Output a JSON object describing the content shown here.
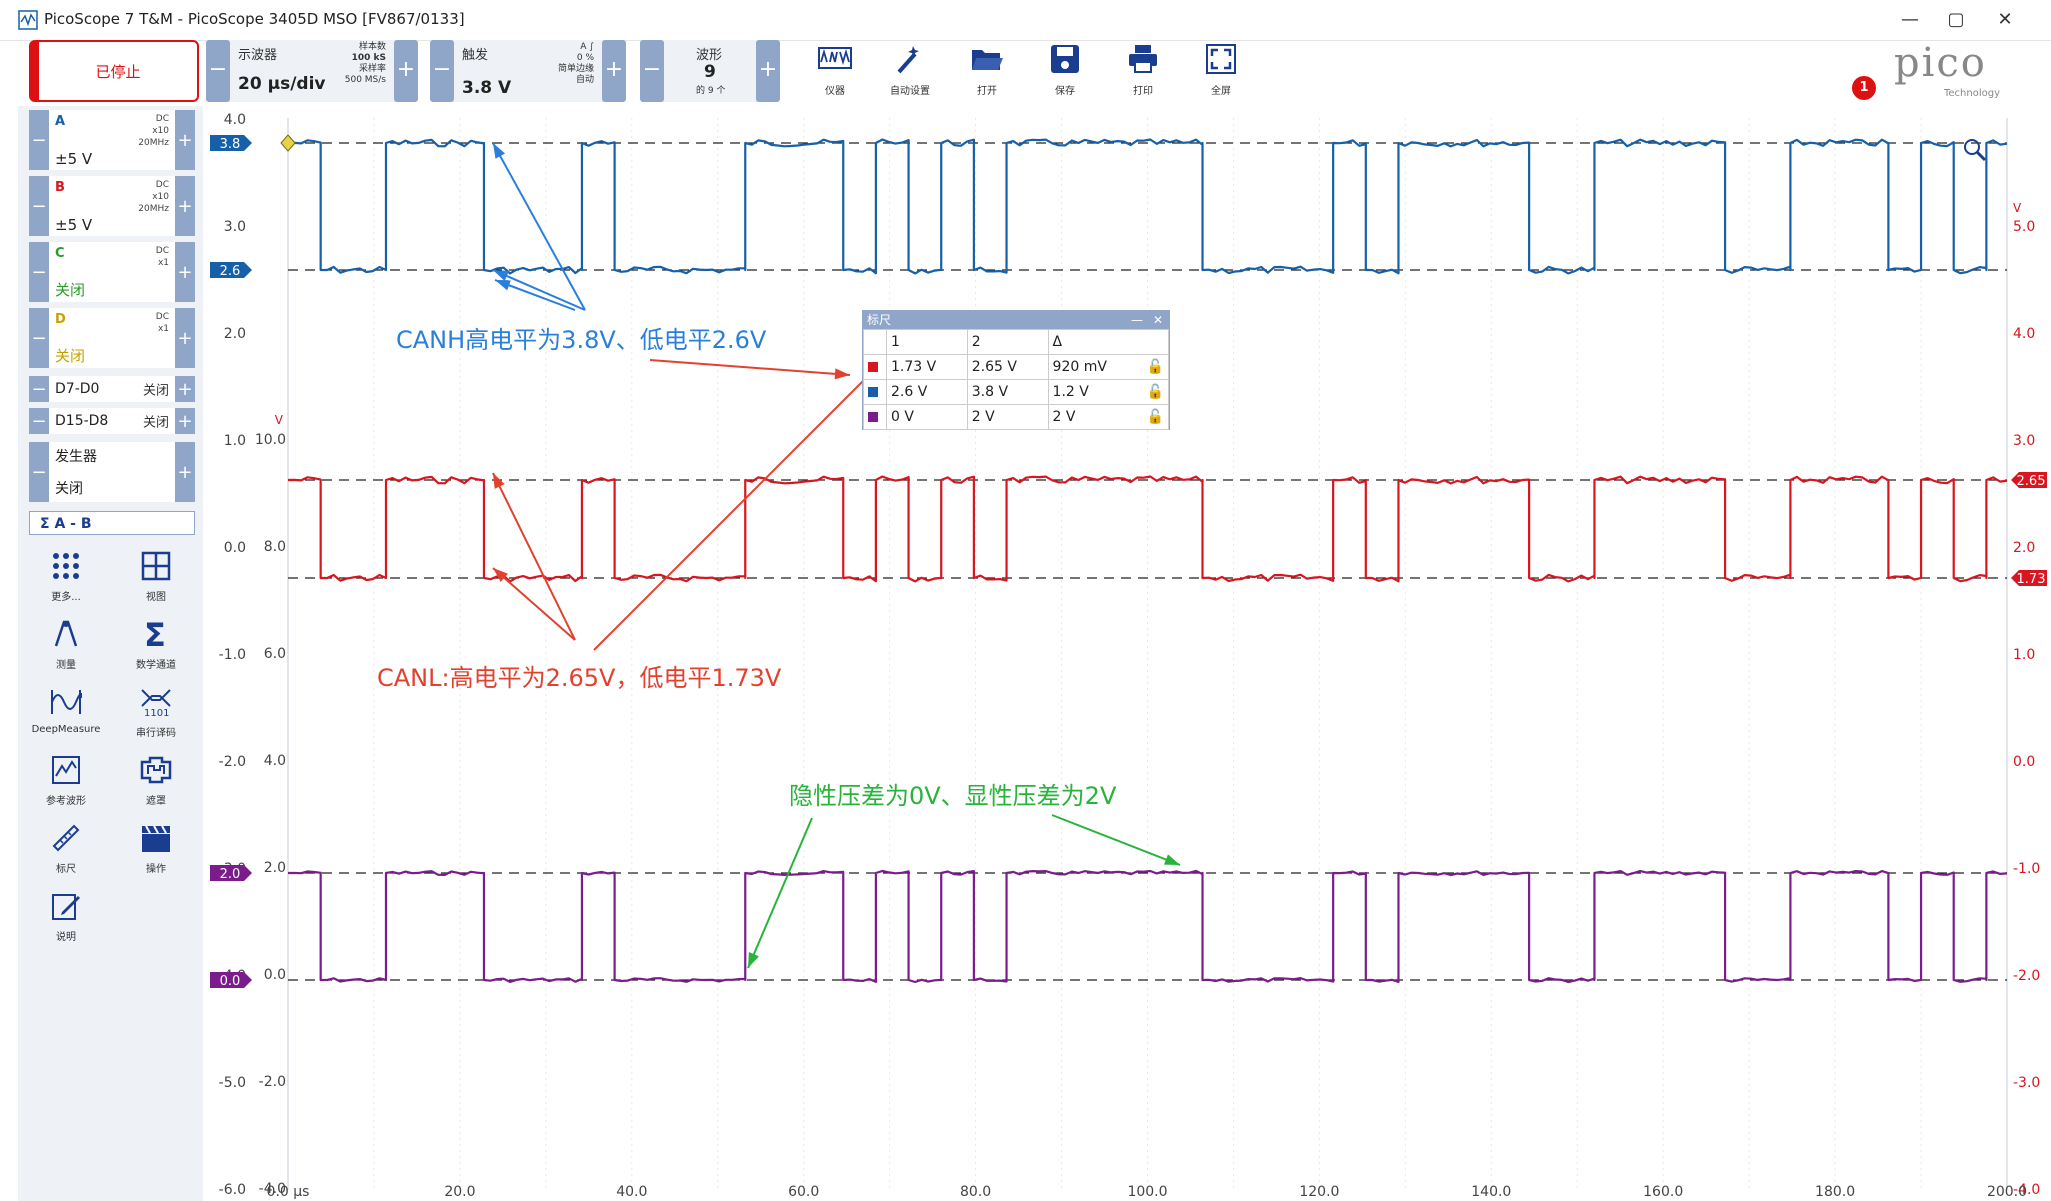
{
  "window": {
    "title": "PicoScope 7 T&M  - PicoScope 3405D MSO [FV867/0133]",
    "controls": [
      "—",
      "▢",
      "✕"
    ]
  },
  "toolbar": {
    "stop_label": "已停止",
    "scope": {
      "title": "示波器",
      "value": "20 μs/div",
      "samples_label": "样本数",
      "samples": "100 kS",
      "rate_label": "采样率",
      "rate": "500 MS/s"
    },
    "trigger": {
      "title": "触发",
      "value": "3.8 V",
      "ch": "A",
      "edge": "∫",
      "pct": "0 %",
      "mode": "简单边缘",
      "auto": "自动"
    },
    "wave": {
      "title": "波形",
      "value": "9",
      "sub": "的 9 个"
    },
    "tools": [
      {
        "label": "仪器",
        "icon": "instruments-icon"
      },
      {
        "label": "自动设置",
        "icon": "auto-setup-icon"
      },
      {
        "label": "打开",
        "icon": "open-folder-icon"
      },
      {
        "label": "保存",
        "icon": "save-icon"
      },
      {
        "label": "打印",
        "icon": "print-icon"
      },
      {
        "label": "全屏",
        "icon": "fullscreen-icon"
      }
    ],
    "notifications": "1",
    "brand": "pico",
    "brand_sub": "Technology"
  },
  "channels": [
    {
      "name": "A",
      "range": "±5 V",
      "coupling": "DC",
      "probe": "x10",
      "bw": "20MHz",
      "color": "#1560a8"
    },
    {
      "name": "B",
      "range": "±5 V",
      "coupling": "DC",
      "probe": "x10",
      "bw": "20MHz",
      "color": "#d9151f"
    },
    {
      "name": "C",
      "range": "关闭",
      "coupling": "DC",
      "probe": "x1",
      "color": "#2a9a2a"
    },
    {
      "name": "D",
      "range": "关闭",
      "coupling": "DC",
      "probe": "x1",
      "color": "#c9a100"
    }
  ],
  "digital": [
    {
      "name": "D7-D0",
      "state": "关闭"
    },
    {
      "name": "D15-D8",
      "state": "关闭"
    }
  ],
  "generator": {
    "label": "发生器",
    "state": "关闭"
  },
  "math_channel": "A - B",
  "side_tools": [
    {
      "label": "更多...",
      "icon": "more-icon"
    },
    {
      "label": "视图",
      "icon": "view-grid-icon"
    },
    {
      "label": "测量",
      "icon": "measure-icon"
    },
    {
      "label": "数学通道",
      "icon": "math-sigma-icon"
    },
    {
      "label": "DeepMeasure",
      "icon": "deepmeasure-icon"
    },
    {
      "label": "串行译码",
      "icon": "serial-decode-icon"
    },
    {
      "label": "参考波形",
      "icon": "reference-wave-icon"
    },
    {
      "label": "遮罩",
      "icon": "mask-icon"
    },
    {
      "label": "标尺",
      "icon": "ruler-icon"
    },
    {
      "label": "操作",
      "icon": "clapper-icon"
    },
    {
      "label": "说明",
      "icon": "notes-icon"
    }
  ],
  "axes": {
    "left_a": [
      "4.0",
      "3.0",
      "2.0",
      "1.0",
      "0.0",
      "-1.0",
      "-2.0",
      "-3.0",
      "-4.0",
      "-5.0",
      "-6.0"
    ],
    "left_b": [
      "10.0",
      "8.0",
      "6.0",
      "4.0",
      "2.0",
      "0.0",
      "-2.0",
      "-4.0"
    ],
    "left_b_unit": "V",
    "right": [
      "5.0",
      "4.0",
      "3.0",
      "2.0",
      "1.0",
      "0.0",
      "-1.0",
      "-2.0",
      "-3.0",
      "-4.0"
    ],
    "right_unit": "V",
    "x": [
      "0.0 μs",
      "20.0",
      "40.0",
      "60.0",
      "80.0",
      "100.0",
      "120.0",
      "140.0",
      "160.0",
      "180.0",
      "200.0"
    ]
  },
  "markers": {
    "a_hi": "3.8",
    "a_lo": "2.6",
    "b_hi": "2.65",
    "b_lo": "1.73",
    "m_hi": "2.0",
    "m_lo": "0.0"
  },
  "signal": {
    "pattern": [
      1,
      0,
      0,
      1,
      1,
      1,
      0,
      0,
      0,
      1,
      0,
      0,
      0,
      0,
      1,
      1,
      1,
      0,
      1,
      0,
      1,
      0,
      1,
      1,
      1,
      1,
      1,
      1,
      0,
      0,
      0,
      0,
      1,
      0,
      1,
      1,
      1,
      1,
      0,
      0,
      1,
      1,
      1,
      1,
      0,
      0,
      1,
      1,
      1,
      0,
      1,
      0,
      1
    ],
    "bit_us": 3.8
  },
  "ruler": {
    "title": "标尺",
    "headers": [
      "1",
      "2",
      "Δ"
    ],
    "rows": [
      {
        "color": "#d9151f",
        "v1": "1.73 V",
        "v2": "2.65 V",
        "d": "920 mV"
      },
      {
        "color": "#1560a8",
        "v1": "2.6 V",
        "v2": "3.8 V",
        "d": "1.2 V"
      },
      {
        "color": "#7a1c8c",
        "v1": "0 V",
        "v2": "2 V",
        "d": "2 V"
      }
    ]
  },
  "annotations": {
    "canh": "CANH高电平为3.8V、低电平2.6V",
    "canl": "CANL:高电平为2.65V，低电平1.73V",
    "diff": "隐性压差为0V、显性压差为2V"
  },
  "colors": {
    "a": "#1560a8",
    "b": "#d9151f",
    "math": "#7a1c8c",
    "blue_ann": "#2a7fdc",
    "red_ann": "#e2412d",
    "green_ann": "#29b33a",
    "ctrl": "#8fa6c8"
  }
}
